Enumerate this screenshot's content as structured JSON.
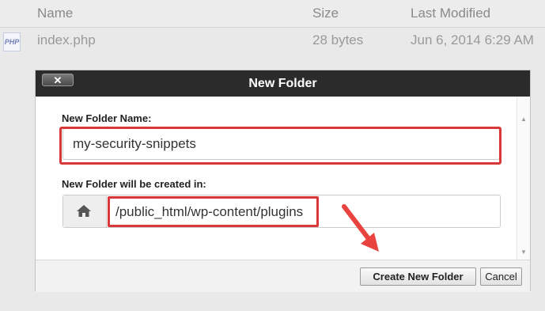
{
  "file_list": {
    "columns": {
      "name": "Name",
      "size": "Size",
      "modified": "Last Modified"
    },
    "rows": [
      {
        "icon": "php-file-icon",
        "icon_text": "PHP",
        "name": "index.php",
        "size": "28 bytes",
        "modified": "Jun 6, 2014 6:29 AM"
      }
    ]
  },
  "dialog": {
    "title": "New Folder",
    "close_label": "✕",
    "name_label": "New Folder Name:",
    "name_value": "my-security-snippets",
    "location_label": "New Folder will be created in:",
    "location_icon": "home-icon",
    "location_path": "/public_html/wp-content/plugins",
    "create_button": "Create New Folder",
    "cancel_button": "Cancel"
  },
  "annotations": {
    "highlight_color": "#d9383a",
    "arrow_color": "#e8433f"
  }
}
